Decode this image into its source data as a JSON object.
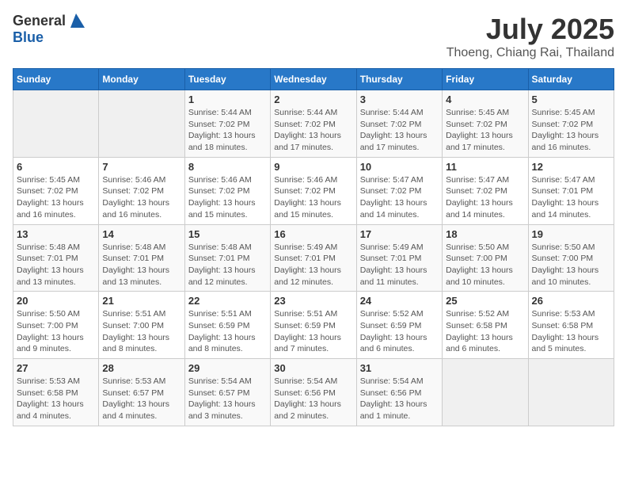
{
  "header": {
    "logo_general": "General",
    "logo_blue": "Blue",
    "title": "July 2025",
    "location": "Thoeng, Chiang Rai, Thailand"
  },
  "days_of_week": [
    "Sunday",
    "Monday",
    "Tuesday",
    "Wednesday",
    "Thursday",
    "Friday",
    "Saturday"
  ],
  "weeks": [
    [
      {
        "day": "",
        "info": ""
      },
      {
        "day": "",
        "info": ""
      },
      {
        "day": "1",
        "info": "Sunrise: 5:44 AM\nSunset: 7:02 PM\nDaylight: 13 hours and 18 minutes."
      },
      {
        "day": "2",
        "info": "Sunrise: 5:44 AM\nSunset: 7:02 PM\nDaylight: 13 hours and 17 minutes."
      },
      {
        "day": "3",
        "info": "Sunrise: 5:44 AM\nSunset: 7:02 PM\nDaylight: 13 hours and 17 minutes."
      },
      {
        "day": "4",
        "info": "Sunrise: 5:45 AM\nSunset: 7:02 PM\nDaylight: 13 hours and 17 minutes."
      },
      {
        "day": "5",
        "info": "Sunrise: 5:45 AM\nSunset: 7:02 PM\nDaylight: 13 hours and 16 minutes."
      }
    ],
    [
      {
        "day": "6",
        "info": "Sunrise: 5:45 AM\nSunset: 7:02 PM\nDaylight: 13 hours and 16 minutes."
      },
      {
        "day": "7",
        "info": "Sunrise: 5:46 AM\nSunset: 7:02 PM\nDaylight: 13 hours and 16 minutes."
      },
      {
        "day": "8",
        "info": "Sunrise: 5:46 AM\nSunset: 7:02 PM\nDaylight: 13 hours and 15 minutes."
      },
      {
        "day": "9",
        "info": "Sunrise: 5:46 AM\nSunset: 7:02 PM\nDaylight: 13 hours and 15 minutes."
      },
      {
        "day": "10",
        "info": "Sunrise: 5:47 AM\nSunset: 7:02 PM\nDaylight: 13 hours and 14 minutes."
      },
      {
        "day": "11",
        "info": "Sunrise: 5:47 AM\nSunset: 7:02 PM\nDaylight: 13 hours and 14 minutes."
      },
      {
        "day": "12",
        "info": "Sunrise: 5:47 AM\nSunset: 7:01 PM\nDaylight: 13 hours and 14 minutes."
      }
    ],
    [
      {
        "day": "13",
        "info": "Sunrise: 5:48 AM\nSunset: 7:01 PM\nDaylight: 13 hours and 13 minutes."
      },
      {
        "day": "14",
        "info": "Sunrise: 5:48 AM\nSunset: 7:01 PM\nDaylight: 13 hours and 13 minutes."
      },
      {
        "day": "15",
        "info": "Sunrise: 5:48 AM\nSunset: 7:01 PM\nDaylight: 13 hours and 12 minutes."
      },
      {
        "day": "16",
        "info": "Sunrise: 5:49 AM\nSunset: 7:01 PM\nDaylight: 13 hours and 12 minutes."
      },
      {
        "day": "17",
        "info": "Sunrise: 5:49 AM\nSunset: 7:01 PM\nDaylight: 13 hours and 11 minutes."
      },
      {
        "day": "18",
        "info": "Sunrise: 5:50 AM\nSunset: 7:00 PM\nDaylight: 13 hours and 10 minutes."
      },
      {
        "day": "19",
        "info": "Sunrise: 5:50 AM\nSunset: 7:00 PM\nDaylight: 13 hours and 10 minutes."
      }
    ],
    [
      {
        "day": "20",
        "info": "Sunrise: 5:50 AM\nSunset: 7:00 PM\nDaylight: 13 hours and 9 minutes."
      },
      {
        "day": "21",
        "info": "Sunrise: 5:51 AM\nSunset: 7:00 PM\nDaylight: 13 hours and 8 minutes."
      },
      {
        "day": "22",
        "info": "Sunrise: 5:51 AM\nSunset: 6:59 PM\nDaylight: 13 hours and 8 minutes."
      },
      {
        "day": "23",
        "info": "Sunrise: 5:51 AM\nSunset: 6:59 PM\nDaylight: 13 hours and 7 minutes."
      },
      {
        "day": "24",
        "info": "Sunrise: 5:52 AM\nSunset: 6:59 PM\nDaylight: 13 hours and 6 minutes."
      },
      {
        "day": "25",
        "info": "Sunrise: 5:52 AM\nSunset: 6:58 PM\nDaylight: 13 hours and 6 minutes."
      },
      {
        "day": "26",
        "info": "Sunrise: 5:53 AM\nSunset: 6:58 PM\nDaylight: 13 hours and 5 minutes."
      }
    ],
    [
      {
        "day": "27",
        "info": "Sunrise: 5:53 AM\nSunset: 6:58 PM\nDaylight: 13 hours and 4 minutes."
      },
      {
        "day": "28",
        "info": "Sunrise: 5:53 AM\nSunset: 6:57 PM\nDaylight: 13 hours and 4 minutes."
      },
      {
        "day": "29",
        "info": "Sunrise: 5:54 AM\nSunset: 6:57 PM\nDaylight: 13 hours and 3 minutes."
      },
      {
        "day": "30",
        "info": "Sunrise: 5:54 AM\nSunset: 6:56 PM\nDaylight: 13 hours and 2 minutes."
      },
      {
        "day": "31",
        "info": "Sunrise: 5:54 AM\nSunset: 6:56 PM\nDaylight: 13 hours and 1 minute."
      },
      {
        "day": "",
        "info": ""
      },
      {
        "day": "",
        "info": ""
      }
    ]
  ]
}
